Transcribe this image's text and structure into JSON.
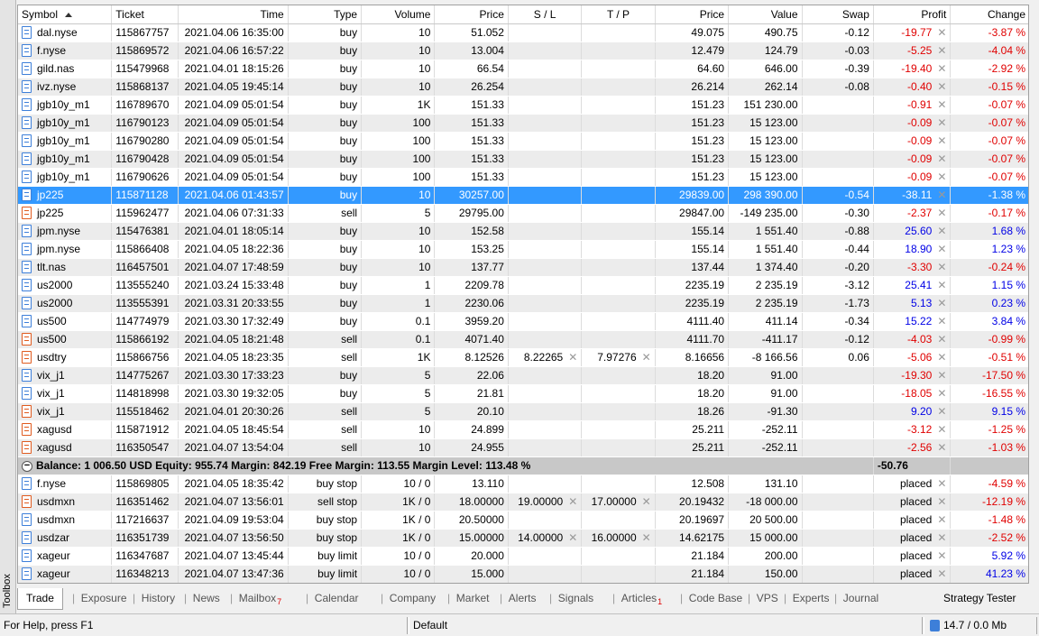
{
  "toolbox_label": "Toolbox",
  "columns": [
    "Symbol",
    "Ticket",
    "Time",
    "Type",
    "Volume",
    "Price",
    "S / L",
    "T / P",
    "Price",
    "Value",
    "Swap",
    "Profit",
    "Change"
  ],
  "rows": [
    {
      "side": "buy",
      "symbol": "dal.nyse",
      "ticket": "115867757",
      "time": "2021.04.06 16:35:00",
      "type": "buy",
      "volume": "10",
      "price": "51.052",
      "sl": "",
      "tp": "",
      "cur": "49.075",
      "value": "490.75",
      "swap": "-0.12",
      "profit": "-19.77",
      "change": "-3.87 %"
    },
    {
      "side": "buy",
      "symbol": "f.nyse",
      "ticket": "115869572",
      "time": "2021.04.06 16:57:22",
      "type": "buy",
      "volume": "10",
      "price": "13.004",
      "sl": "",
      "tp": "",
      "cur": "12.479",
      "value": "124.79",
      "swap": "-0.03",
      "profit": "-5.25",
      "change": "-4.04 %"
    },
    {
      "side": "buy",
      "symbol": "gild.nas",
      "ticket": "115479968",
      "time": "2021.04.01 18:15:26",
      "type": "buy",
      "volume": "10",
      "price": "66.54",
      "sl": "",
      "tp": "",
      "cur": "64.60",
      "value": "646.00",
      "swap": "-0.39",
      "profit": "-19.40",
      "change": "-2.92 %"
    },
    {
      "side": "buy",
      "symbol": "ivz.nyse",
      "ticket": "115868137",
      "time": "2021.04.05 19:45:14",
      "type": "buy",
      "volume": "10",
      "price": "26.254",
      "sl": "",
      "tp": "",
      "cur": "26.214",
      "value": "262.14",
      "swap": "-0.08",
      "profit": "-0.40",
      "change": "-0.15 %"
    },
    {
      "side": "buy",
      "symbol": "jgb10y_m1",
      "ticket": "116789670",
      "time": "2021.04.09 05:01:54",
      "type": "buy",
      "volume": "1K",
      "price": "151.33",
      "sl": "",
      "tp": "",
      "cur": "151.23",
      "value": "151 230.00",
      "swap": "",
      "profit": "-0.91",
      "change": "-0.07 %"
    },
    {
      "side": "buy",
      "symbol": "jgb10y_m1",
      "ticket": "116790123",
      "time": "2021.04.09 05:01:54",
      "type": "buy",
      "volume": "100",
      "price": "151.33",
      "sl": "",
      "tp": "",
      "cur": "151.23",
      "value": "15 123.00",
      "swap": "",
      "profit": "-0.09",
      "change": "-0.07 %"
    },
    {
      "side": "buy",
      "symbol": "jgb10y_m1",
      "ticket": "116790280",
      "time": "2021.04.09 05:01:54",
      "type": "buy",
      "volume": "100",
      "price": "151.33",
      "sl": "",
      "tp": "",
      "cur": "151.23",
      "value": "15 123.00",
      "swap": "",
      "profit": "-0.09",
      "change": "-0.07 %"
    },
    {
      "side": "buy",
      "symbol": "jgb10y_m1",
      "ticket": "116790428",
      "time": "2021.04.09 05:01:54",
      "type": "buy",
      "volume": "100",
      "price": "151.33",
      "sl": "",
      "tp": "",
      "cur": "151.23",
      "value": "15 123.00",
      "swap": "",
      "profit": "-0.09",
      "change": "-0.07 %"
    },
    {
      "side": "buy",
      "symbol": "jgb10y_m1",
      "ticket": "116790626",
      "time": "2021.04.09 05:01:54",
      "type": "buy",
      "volume": "100",
      "price": "151.33",
      "sl": "",
      "tp": "",
      "cur": "151.23",
      "value": "15 123.00",
      "swap": "",
      "profit": "-0.09",
      "change": "-0.07 %"
    },
    {
      "side": "buy",
      "symbol": "jp225",
      "ticket": "115871128",
      "time": "2021.04.06 01:43:57",
      "type": "buy",
      "volume": "10",
      "price": "30257.00",
      "sl": "",
      "tp": "",
      "cur": "29839.00",
      "value": "298 390.00",
      "swap": "-0.54",
      "profit": "-38.11",
      "change": "-1.38 %",
      "selected": true
    },
    {
      "side": "sell",
      "symbol": "jp225",
      "ticket": "115962477",
      "time": "2021.04.06 07:31:33",
      "type": "sell",
      "volume": "5",
      "price": "29795.00",
      "sl": "",
      "tp": "",
      "cur": "29847.00",
      "value": "-149 235.00",
      "swap": "-0.30",
      "profit": "-2.37",
      "change": "-0.17 %"
    },
    {
      "side": "buy",
      "symbol": "jpm.nyse",
      "ticket": "115476381",
      "time": "2021.04.01 18:05:14",
      "type": "buy",
      "volume": "10",
      "price": "152.58",
      "sl": "",
      "tp": "",
      "cur": "155.14",
      "value": "1 551.40",
      "swap": "-0.88",
      "profit": "25.60",
      "change": "1.68 %"
    },
    {
      "side": "buy",
      "symbol": "jpm.nyse",
      "ticket": "115866408",
      "time": "2021.04.05 18:22:36",
      "type": "buy",
      "volume": "10",
      "price": "153.25",
      "sl": "",
      "tp": "",
      "cur": "155.14",
      "value": "1 551.40",
      "swap": "-0.44",
      "profit": "18.90",
      "change": "1.23 %"
    },
    {
      "side": "buy",
      "symbol": "tlt.nas",
      "ticket": "116457501",
      "time": "2021.04.07 17:48:59",
      "type": "buy",
      "volume": "10",
      "price": "137.77",
      "sl": "",
      "tp": "",
      "cur": "137.44",
      "value": "1 374.40",
      "swap": "-0.20",
      "profit": "-3.30",
      "change": "-0.24 %"
    },
    {
      "side": "buy",
      "symbol": "us2000",
      "ticket": "113555240",
      "time": "2021.03.24 15:33:48",
      "type": "buy",
      "volume": "1",
      "price": "2209.78",
      "sl": "",
      "tp": "",
      "cur": "2235.19",
      "value": "2 235.19",
      "swap": "-3.12",
      "profit": "25.41",
      "change": "1.15 %"
    },
    {
      "side": "buy",
      "symbol": "us2000",
      "ticket": "113555391",
      "time": "2021.03.31 20:33:55",
      "type": "buy",
      "volume": "1",
      "price": "2230.06",
      "sl": "",
      "tp": "",
      "cur": "2235.19",
      "value": "2 235.19",
      "swap": "-1.73",
      "profit": "5.13",
      "change": "0.23 %"
    },
    {
      "side": "buy",
      "symbol": "us500",
      "ticket": "114774979",
      "time": "2021.03.30 17:32:49",
      "type": "buy",
      "volume": "0.1",
      "price": "3959.20",
      "sl": "",
      "tp": "",
      "cur": "4111.40",
      "value": "411.14",
      "swap": "-0.34",
      "profit": "15.22",
      "change": "3.84 %"
    },
    {
      "side": "sell",
      "symbol": "us500",
      "ticket": "115866192",
      "time": "2021.04.05 18:21:48",
      "type": "sell",
      "volume": "0.1",
      "price": "4071.40",
      "sl": "",
      "tp": "",
      "cur": "4111.70",
      "value": "-411.17",
      "swap": "-0.12",
      "profit": "-4.03",
      "change": "-0.99 %"
    },
    {
      "side": "sell",
      "symbol": "usdtry",
      "ticket": "115866756",
      "time": "2021.04.05 18:23:35",
      "type": "sell",
      "volume": "1K",
      "price": "8.12526",
      "sl": "8.22265",
      "tp": "7.97276",
      "cur": "8.16656",
      "value": "-8 166.56",
      "swap": "0.06",
      "profit": "-5.06",
      "change": "-0.51 %"
    },
    {
      "side": "buy",
      "symbol": "vix_j1",
      "ticket": "114775267",
      "time": "2021.03.30 17:33:23",
      "type": "buy",
      "volume": "5",
      "price": "22.06",
      "sl": "",
      "tp": "",
      "cur": "18.20",
      "value": "91.00",
      "swap": "",
      "profit": "-19.30",
      "change": "-17.50 %"
    },
    {
      "side": "buy",
      "symbol": "vix_j1",
      "ticket": "114818998",
      "time": "2021.03.30 19:32:05",
      "type": "buy",
      "volume": "5",
      "price": "21.81",
      "sl": "",
      "tp": "",
      "cur": "18.20",
      "value": "91.00",
      "swap": "",
      "profit": "-18.05",
      "change": "-16.55 %"
    },
    {
      "side": "sell",
      "symbol": "vix_j1",
      "ticket": "115518462",
      "time": "2021.04.01 20:30:26",
      "type": "sell",
      "volume": "5",
      "price": "20.10",
      "sl": "",
      "tp": "",
      "cur": "18.26",
      "value": "-91.30",
      "swap": "",
      "profit": "9.20",
      "change": "9.15 %"
    },
    {
      "side": "sell",
      "symbol": "xagusd",
      "ticket": "115871912",
      "time": "2021.04.05 18:45:54",
      "type": "sell",
      "volume": "10",
      "price": "24.899",
      "sl": "",
      "tp": "",
      "cur": "25.211",
      "value": "-252.11",
      "swap": "",
      "profit": "-3.12",
      "change": "-1.25 %"
    },
    {
      "side": "sell",
      "symbol": "xagusd",
      "ticket": "116350547",
      "time": "2021.04.07 13:54:04",
      "type": "sell",
      "volume": "10",
      "price": "24.955",
      "sl": "",
      "tp": "",
      "cur": "25.211",
      "value": "-252.11",
      "swap": "",
      "profit": "-2.56",
      "change": "-1.03 %"
    }
  ],
  "balance": {
    "text": "Balance: 1 006.50 USD  Equity: 955.74  Margin: 842.19  Free Margin: 113.55  Margin Level: 113.48 %",
    "profit": "-50.76"
  },
  "orders": [
    {
      "side": "buy",
      "symbol": "f.nyse",
      "ticket": "115869805",
      "time": "2021.04.05 18:35:42",
      "type": "buy stop",
      "volume": "10 / 0",
      "price": "13.110",
      "sl": "",
      "tp": "",
      "cur": "12.508",
      "value": "131.10",
      "swap": "",
      "profit": "placed",
      "change": "-4.59 %"
    },
    {
      "side": "sell",
      "symbol": "usdmxn",
      "ticket": "116351462",
      "time": "2021.04.07 13:56:01",
      "type": "sell stop",
      "volume": "1K / 0",
      "price": "18.00000",
      "sl": "19.00000",
      "tp": "17.00000",
      "cur": "20.19432",
      "value": "-18 000.00",
      "swap": "",
      "profit": "placed",
      "change": "-12.19 %"
    },
    {
      "side": "buy",
      "symbol": "usdmxn",
      "ticket": "117216637",
      "time": "2021.04.09 19:53:04",
      "type": "buy stop",
      "volume": "1K / 0",
      "price": "20.50000",
      "sl": "",
      "tp": "",
      "cur": "20.19697",
      "value": "20 500.00",
      "swap": "",
      "profit": "placed",
      "change": "-1.48 %"
    },
    {
      "side": "buy",
      "symbol": "usdzar",
      "ticket": "116351739",
      "time": "2021.04.07 13:56:50",
      "type": "buy stop",
      "volume": "1K / 0",
      "price": "15.00000",
      "sl": "14.00000",
      "tp": "16.00000",
      "cur": "14.62175",
      "value": "15 000.00",
      "swap": "",
      "profit": "placed",
      "change": "-2.52 %"
    },
    {
      "side": "buy",
      "symbol": "xageur",
      "ticket": "116347687",
      "time": "2021.04.07 13:45:44",
      "type": "buy limit",
      "volume": "10 / 0",
      "price": "20.000",
      "sl": "",
      "tp": "",
      "cur": "21.184",
      "value": "200.00",
      "swap": "",
      "profit": "placed",
      "change": "5.92 %"
    },
    {
      "side": "buy",
      "symbol": "xageur",
      "ticket": "116348213",
      "time": "2021.04.07 13:47:36",
      "type": "buy limit",
      "volume": "10 / 0",
      "price": "15.000",
      "sl": "",
      "tp": "",
      "cur": "21.184",
      "value": "150.00",
      "swap": "",
      "profit": "placed",
      "change": "41.23 %"
    }
  ],
  "tabs": [
    {
      "label": "Trade",
      "active": true
    },
    {
      "label": "Exposure"
    },
    {
      "label": "History"
    },
    {
      "label": "News"
    },
    {
      "label": "Mailbox",
      "badge": "7"
    },
    {
      "label": "Calendar"
    },
    {
      "label": "Company"
    },
    {
      "label": "Market"
    },
    {
      "label": "Alerts"
    },
    {
      "label": "Signals"
    },
    {
      "label": "Articles",
      "badge": "1"
    },
    {
      "label": "Code Base"
    },
    {
      "label": "VPS"
    },
    {
      "label": "Experts"
    },
    {
      "label": "Journal"
    }
  ],
  "strategy_tester": "Strategy Tester",
  "status": {
    "help": "For Help, press F1",
    "profile": "Default",
    "traffic": "14.7 / 0.0 Mb"
  },
  "colors": {
    "selection": "#3399ff",
    "loss": "#e00000",
    "gain": "#0000e6",
    "buy_icon": "#3d7fd9",
    "sell_icon": "#e05b1f"
  }
}
